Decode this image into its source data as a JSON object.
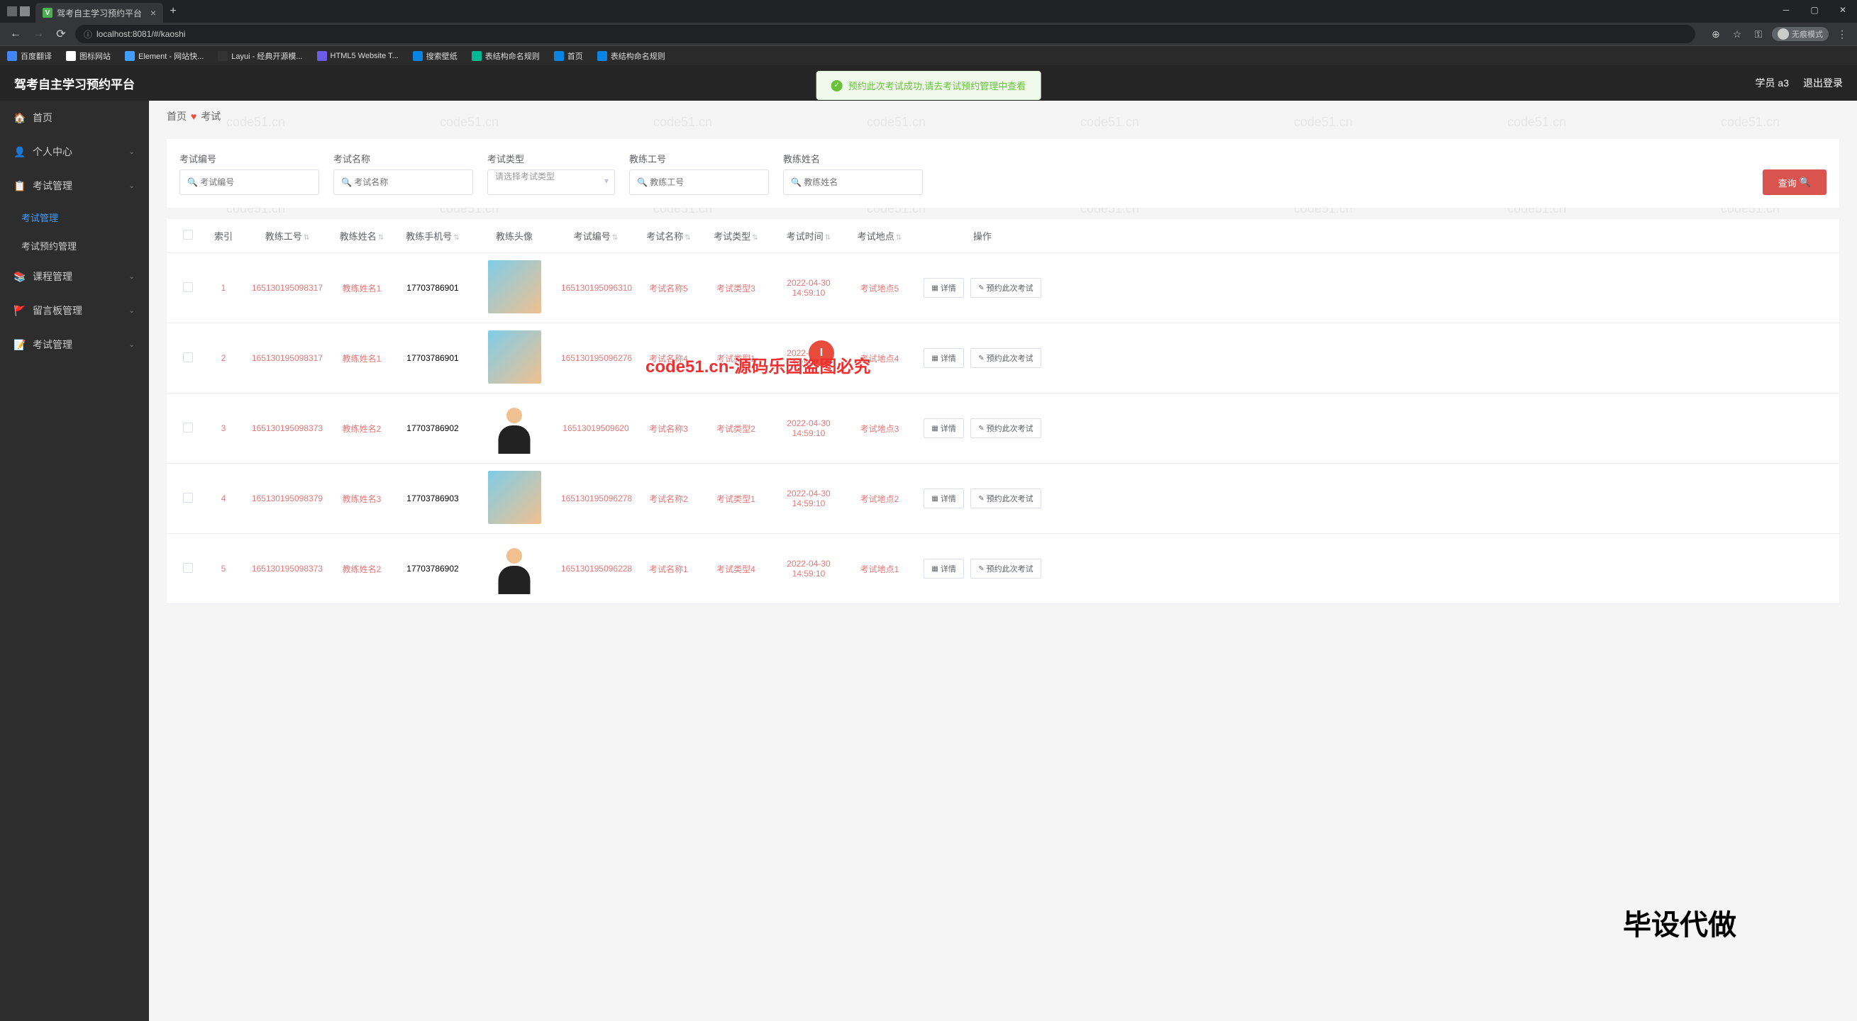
{
  "browser": {
    "tab_title": "驾考自主学习预约平台",
    "url": "localhost:8081/#/kaoshi",
    "guest_mode": "无痕模式",
    "bookmarks": [
      {
        "label": "百度翻译",
        "color": "#4285f4"
      },
      {
        "label": "图标网站",
        "color": "#fff"
      },
      {
        "label": "Element - 网站快...",
        "color": "#409eff"
      },
      {
        "label": "Layui - 经典开源模...",
        "color": "#333"
      },
      {
        "label": "HTML5 Website T...",
        "color": "#6c5ce7"
      },
      {
        "label": "搜索壁纸",
        "color": "#0984e3"
      },
      {
        "label": "表结构命名规则",
        "color": "#00b894"
      },
      {
        "label": "首页",
        "color": "#0984e3"
      },
      {
        "label": "表结构命名规则",
        "color": "#0984e3"
      }
    ]
  },
  "app": {
    "title": "驾考自主学习预约平台",
    "user_label": "学员 a3",
    "logout": "退出登录"
  },
  "toast": {
    "message": "预约此次考试成功,请去考试预约管理中查看"
  },
  "sidebar": {
    "items": [
      {
        "icon": "🏠",
        "label": "首页",
        "children": []
      },
      {
        "icon": "👤",
        "label": "个人中心",
        "children": []
      },
      {
        "icon": "📋",
        "label": "考试管理",
        "expanded": true,
        "children": [
          "考试管理",
          "考试预约管理"
        ]
      },
      {
        "icon": "📚",
        "label": "课程管理",
        "children": []
      },
      {
        "icon": "🚩",
        "label": "留言板管理",
        "children": []
      },
      {
        "icon": "📝",
        "label": "考试管理",
        "children": []
      }
    ]
  },
  "breadcrumb": {
    "home": "首页",
    "current": "考试"
  },
  "search": {
    "fields": [
      {
        "label": "考试编号",
        "placeholder": "考试编号",
        "type": "input"
      },
      {
        "label": "考试名称",
        "placeholder": "考试名称",
        "type": "input"
      },
      {
        "label": "考试类型",
        "placeholder": "请选择考试类型",
        "type": "select"
      },
      {
        "label": "教练工号",
        "placeholder": "教练工号",
        "type": "input"
      },
      {
        "label": "教练姓名",
        "placeholder": "教练姓名",
        "type": "input"
      }
    ],
    "button": "查询"
  },
  "table": {
    "headers": {
      "index": "索引",
      "coach_id": "教练工号",
      "coach_name": "教练姓名",
      "coach_phone": "教练手机号",
      "coach_avatar": "教练头像",
      "exam_id": "考试编号",
      "exam_name": "考试名称",
      "exam_type": "考试类型",
      "exam_time": "考试时间",
      "exam_loc": "考试地点",
      "ops": "操作"
    },
    "op_detail": "详情",
    "op_book": "预约此次考试",
    "rows": [
      {
        "idx": "1",
        "coach_id": "165130195098317",
        "coach_name": "教练姓名1",
        "coach_phone": "17703786901",
        "exam_id": "165130195096310",
        "exam_name": "考试名称5",
        "exam_type": "考试类型3",
        "exam_time": "2022-04-30 14:59:10",
        "exam_loc": "考试地点5",
        "avatar": "blue"
      },
      {
        "idx": "2",
        "coach_id": "165130195098317",
        "coach_name": "教练姓名1",
        "coach_phone": "17703786901",
        "exam_id": "165130195096276",
        "exam_name": "考试名称4",
        "exam_type": "考试类型1",
        "exam_time": "2022-04-30 14:59:10",
        "exam_loc": "考试地点4",
        "avatar": "blue"
      },
      {
        "idx": "3",
        "coach_id": "165130195098373",
        "coach_name": "教练姓名2",
        "coach_phone": "17703786902",
        "exam_id": "16513019509620",
        "exam_name": "考试名称3",
        "exam_type": "考试类型2",
        "exam_time": "2022-04-30 14:59:10",
        "exam_loc": "考试地点3",
        "avatar": "person"
      },
      {
        "idx": "4",
        "coach_id": "165130195098379",
        "coach_name": "教练姓名3",
        "coach_phone": "17703786903",
        "exam_id": "165130195096278",
        "exam_name": "考试名称2",
        "exam_type": "考试类型1",
        "exam_time": "2022-04-30 14:59:10",
        "exam_loc": "考试地点2",
        "avatar": "blue"
      },
      {
        "idx": "5",
        "coach_id": "165130195098373",
        "coach_name": "教练姓名2",
        "coach_phone": "17703786902",
        "exam_id": "165130195096228",
        "exam_name": "考试名称1",
        "exam_type": "考试类型4",
        "exam_time": "2022-04-30 14:59:10",
        "exam_loc": "考试地点1",
        "avatar": "person"
      }
    ]
  },
  "watermark": "code51.cn",
  "overlay": {
    "red": "code51.cn-源码乐园盗图必究",
    "black": "毕设代做"
  }
}
